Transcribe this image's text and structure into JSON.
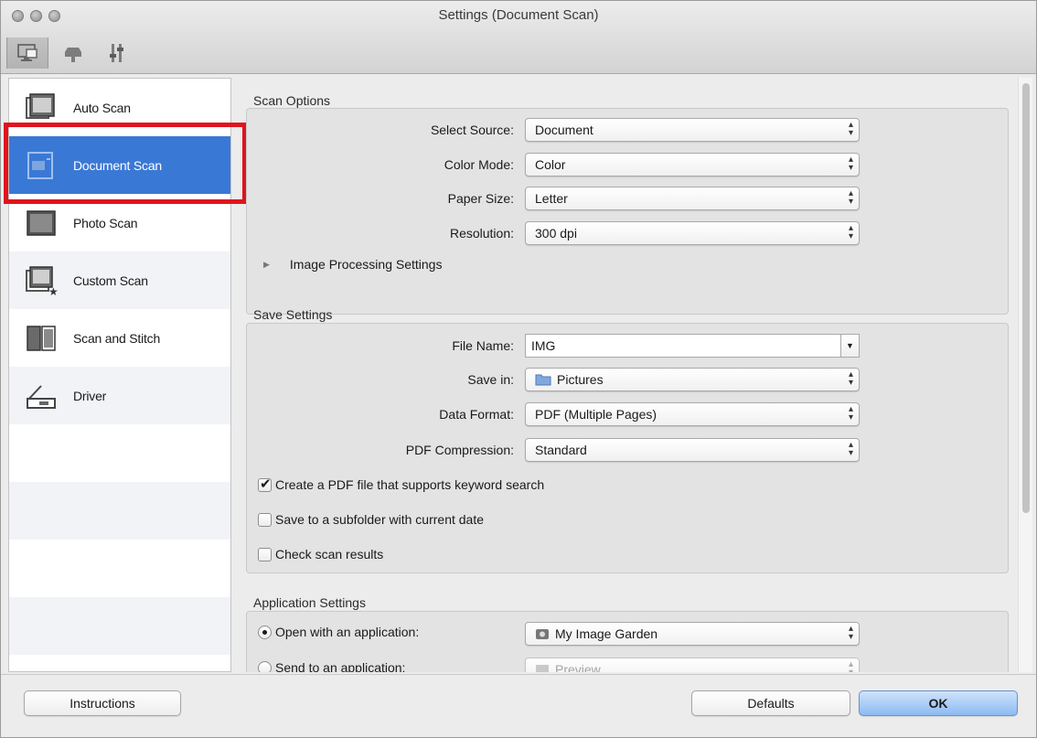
{
  "window": {
    "title": "Settings (Document Scan)"
  },
  "toolbar": {
    "tabs": [
      {
        "icon": "computer-scan-icon"
      },
      {
        "icon": "scanner-operation-panel-icon"
      },
      {
        "icon": "general-settings-icon"
      }
    ]
  },
  "sidebar": {
    "items": [
      {
        "label": "Auto Scan",
        "icon": "auto-scan-icon"
      },
      {
        "label": "Document Scan",
        "icon": "document-scan-icon",
        "selected": true
      },
      {
        "label": "Photo Scan",
        "icon": "photo-scan-icon"
      },
      {
        "label": "Custom Scan",
        "icon": "custom-scan-icon"
      },
      {
        "label": "Scan and Stitch",
        "icon": "scan-and-stitch-icon"
      },
      {
        "label": "Driver",
        "icon": "driver-icon"
      }
    ]
  },
  "scan_options": {
    "title": "Scan Options",
    "select_source": {
      "label": "Select Source:",
      "value": "Document"
    },
    "color_mode": {
      "label": "Color Mode:",
      "value": "Color"
    },
    "paper_size": {
      "label": "Paper Size:",
      "value": "Letter"
    },
    "resolution": {
      "label": "Resolution:",
      "value": "300 dpi"
    },
    "image_processing": "Image Processing Settings"
  },
  "save_settings": {
    "title": "Save Settings",
    "file_name": {
      "label": "File Name:",
      "value": "IMG"
    },
    "save_in": {
      "label": "Save in:",
      "value": "Pictures"
    },
    "data_format": {
      "label": "Data Format:",
      "value": "PDF (Multiple Pages)"
    },
    "pdf_compression": {
      "label": "PDF Compression:",
      "value": "Standard"
    },
    "keyword_search": {
      "label": "Create a PDF file that supports keyword search",
      "checked": true
    },
    "subfolder": {
      "label": "Save to a subfolder with current date",
      "checked": false
    },
    "check_results": {
      "label": "Check scan results",
      "checked": false
    }
  },
  "application_settings": {
    "title": "Application Settings",
    "open_with": {
      "label": "Open with an application:",
      "value": "My Image Garden",
      "selected": true
    },
    "send_to": {
      "label": "Send to an application:",
      "value": "Preview",
      "selected": false
    }
  },
  "buttons": {
    "instructions": "Instructions",
    "defaults": "Defaults",
    "ok": "OK"
  },
  "colors": {
    "selection": "#3a78d6",
    "highlight_border": "#e0141d",
    "default_button": "#8cbaf2"
  }
}
